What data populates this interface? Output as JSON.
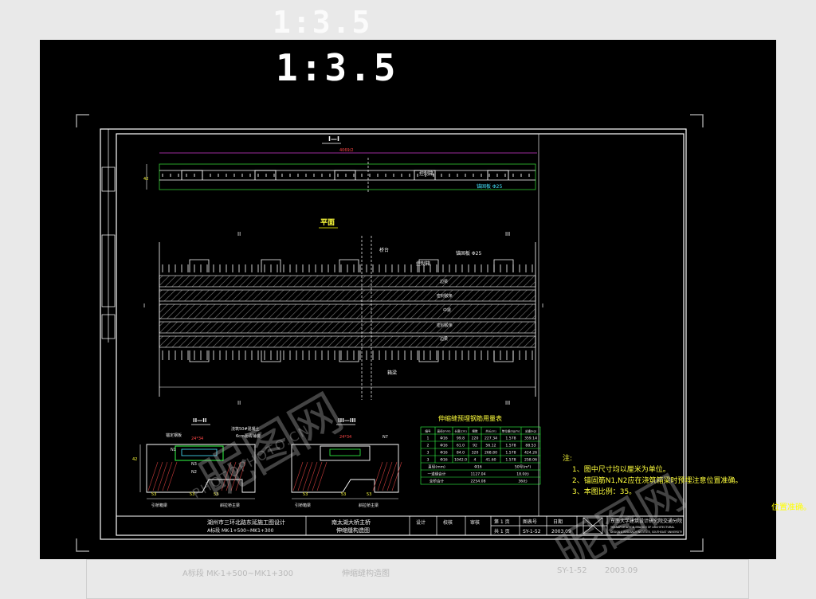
{
  "scale_label": "1:3.5",
  "sections": {
    "elevation_title": "I—I",
    "plan_title": "平面",
    "sec2_title": "II—II",
    "sec3_title": "III—III",
    "cut_II": "II",
    "cut_III": "III",
    "cut_I": "I"
  },
  "labels": {
    "control_box": "控制箱",
    "anchor_plate": "锚固板 Φ25",
    "pier_cap": "桥台",
    "edge_beam": "边梁",
    "seal_strip": "密封胶条",
    "middle_beam": "中梁",
    "anchor_beam": "箱梁",
    "anchor_rebar": "锚定钢板",
    "concrete_note_1": "浇筑50#混凝土",
    "concrete_note_2": "6cm沥青铺装",
    "approach_box": "引桥箱梁",
    "main_box": "斜拉桥主梁",
    "approach_box_3": "引桥箱梁",
    "main_box_3": "斜拉桥主梁",
    "dim_top": "4069/2",
    "dim_left": "42",
    "dim_24": "24*34"
  },
  "table": {
    "title": "伸缩缝预埋钢筋用量表",
    "headers": [
      "编号",
      "直径(mm)",
      "长度(cm)",
      "根数",
      "共长(m)",
      "单位重(kg/m)",
      "总重(kg)"
    ],
    "rows": [
      [
        "1",
        "Φ16",
        "99.8",
        "220",
        "227.34",
        "1.578",
        "359.14"
      ],
      [
        "2",
        "Φ16",
        "61.0",
        "92",
        "56.12",
        "1.578",
        "88.53"
      ],
      [
        "3",
        "Φ16",
        "84.0",
        "320",
        "268.80",
        "1.578",
        "424.26"
      ],
      [
        "3",
        "Φ16",
        "1042.0",
        "4",
        "41.60",
        "1.578",
        "258.06"
      ]
    ],
    "footer": [
      [
        "直径(mm)",
        "Φ16",
        "50号(m³)"
      ],
      [
        "一道缝合计",
        "1127.04",
        "18.0(t)"
      ],
      [
        "全桥合计",
        "2254.08",
        "36(t)"
      ]
    ]
  },
  "notes": {
    "title": "注:",
    "items": [
      "1、图中尺寸均以厘米为单位。",
      "2、锚固筋N1,N2应在浇筑箱梁时预埋注意位置准确。",
      "3、本图比例：35。"
    ]
  },
  "title_block": {
    "project_line1": "湖州市三环北路东延施工图设计",
    "project_line2": "A标段 MK-1+500~MK1+300",
    "drawing_line1": "南太湖大桥主桥",
    "drawing_line2": "伸缩缝构造图",
    "design": "设计",
    "check": "校核",
    "review": "审核",
    "page": "第 1 页",
    "total": "共 1 页",
    "drawing_no_label": "图表号",
    "drawing_no": "SY-1-52",
    "date_label": "日期",
    "date": "2003.09",
    "institute_cn": "东南大学建筑设计研究院交通分院",
    "institute_en1": "TRANSPORTATION BRANCH OF ARCHITECTURAL",
    "institute_en2": "DESIGN & RESEARCH INSTITUTE, SOUTHEAST UNIVERSITY"
  },
  "watermark": {
    "brand": "昵图网",
    "url": "PHOTOPHOTO.CN"
  },
  "side_note": "位置准确。"
}
